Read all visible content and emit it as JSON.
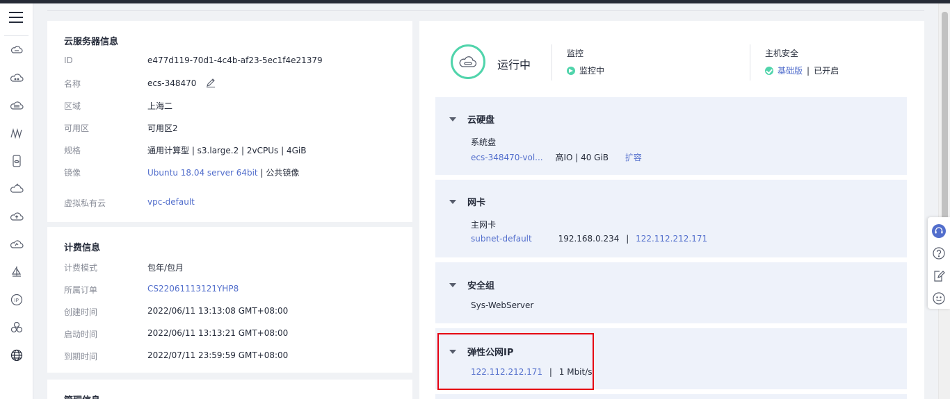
{
  "colors": {
    "accent": "#526ecc",
    "status_green": "#50d4ab",
    "highlight_red": "#e60012",
    "panel_bg": "#eef2fa"
  },
  "rail_icons": [
    "cloud-server-icon",
    "cloud-icon",
    "cloud-disk-icon",
    "chart-icon",
    "database-icon",
    "cloud-sync-icon",
    "cloud-upload-icon",
    "cloud-download-icon",
    "sailboat-icon",
    "ip-icon",
    "cluster-icon",
    "globe-icon"
  ],
  "server_info": {
    "title": "云服务器信息",
    "rows": [
      {
        "label": "ID",
        "value": "e477d119-70d1-4c4b-af23-5ec1f4e21379"
      },
      {
        "label": "名称",
        "value": "ecs-348470"
      },
      {
        "label": "区域",
        "value": "上海二"
      },
      {
        "label": "可用区",
        "value": "可用区2"
      },
      {
        "label": "规格",
        "value": "通用计算型 | s3.large.2 | 2vCPUs | 4GiB"
      },
      {
        "label": "镜像",
        "value_link": "Ubuntu 18.04 server 64bit",
        "value_rest": " | 公共镜像"
      },
      {
        "label": "虚拟私有云",
        "value": "vpc-default"
      }
    ]
  },
  "billing_info": {
    "title": "计费信息",
    "rows": [
      {
        "label": "计费模式",
        "value": "包年/包月"
      },
      {
        "label": "所属订单",
        "value": "CS22061113121YHP8"
      },
      {
        "label": "创建时间",
        "value": "2022/06/11 13:13:08 GMT+08:00"
      },
      {
        "label": "启动时间",
        "value": "2022/06/11 13:13:21 GMT+08:00"
      },
      {
        "label": "到期时间",
        "value": "2022/07/11 23:59:59 GMT+08:00"
      }
    ]
  },
  "management_info": {
    "title": "管理信息"
  },
  "status": {
    "label": "运行中",
    "monitor_title": "监控",
    "monitor_value": "监控中",
    "security_title": "主机安全",
    "security_link": "基础版",
    "security_value": "已开启"
  },
  "panels": {
    "disk": {
      "title": "云硬盘",
      "sub_label": "系统盘",
      "disk_name": "ecs-348470-vol...",
      "disk_spec": "高IO  |  40 GiB",
      "expand": "扩容"
    },
    "nic": {
      "title": "网卡",
      "sub_label": "主网卡",
      "subnet": "subnet-default",
      "private_ip": "192.168.0.234",
      "public_ip": "122.112.212.171"
    },
    "secgroup": {
      "title": "安全组",
      "name": "Sys-WebServer"
    },
    "eip": {
      "title": "弹性公网IP",
      "ip": "122.112.212.171",
      "bandwidth": "1 Mbit/s"
    }
  }
}
